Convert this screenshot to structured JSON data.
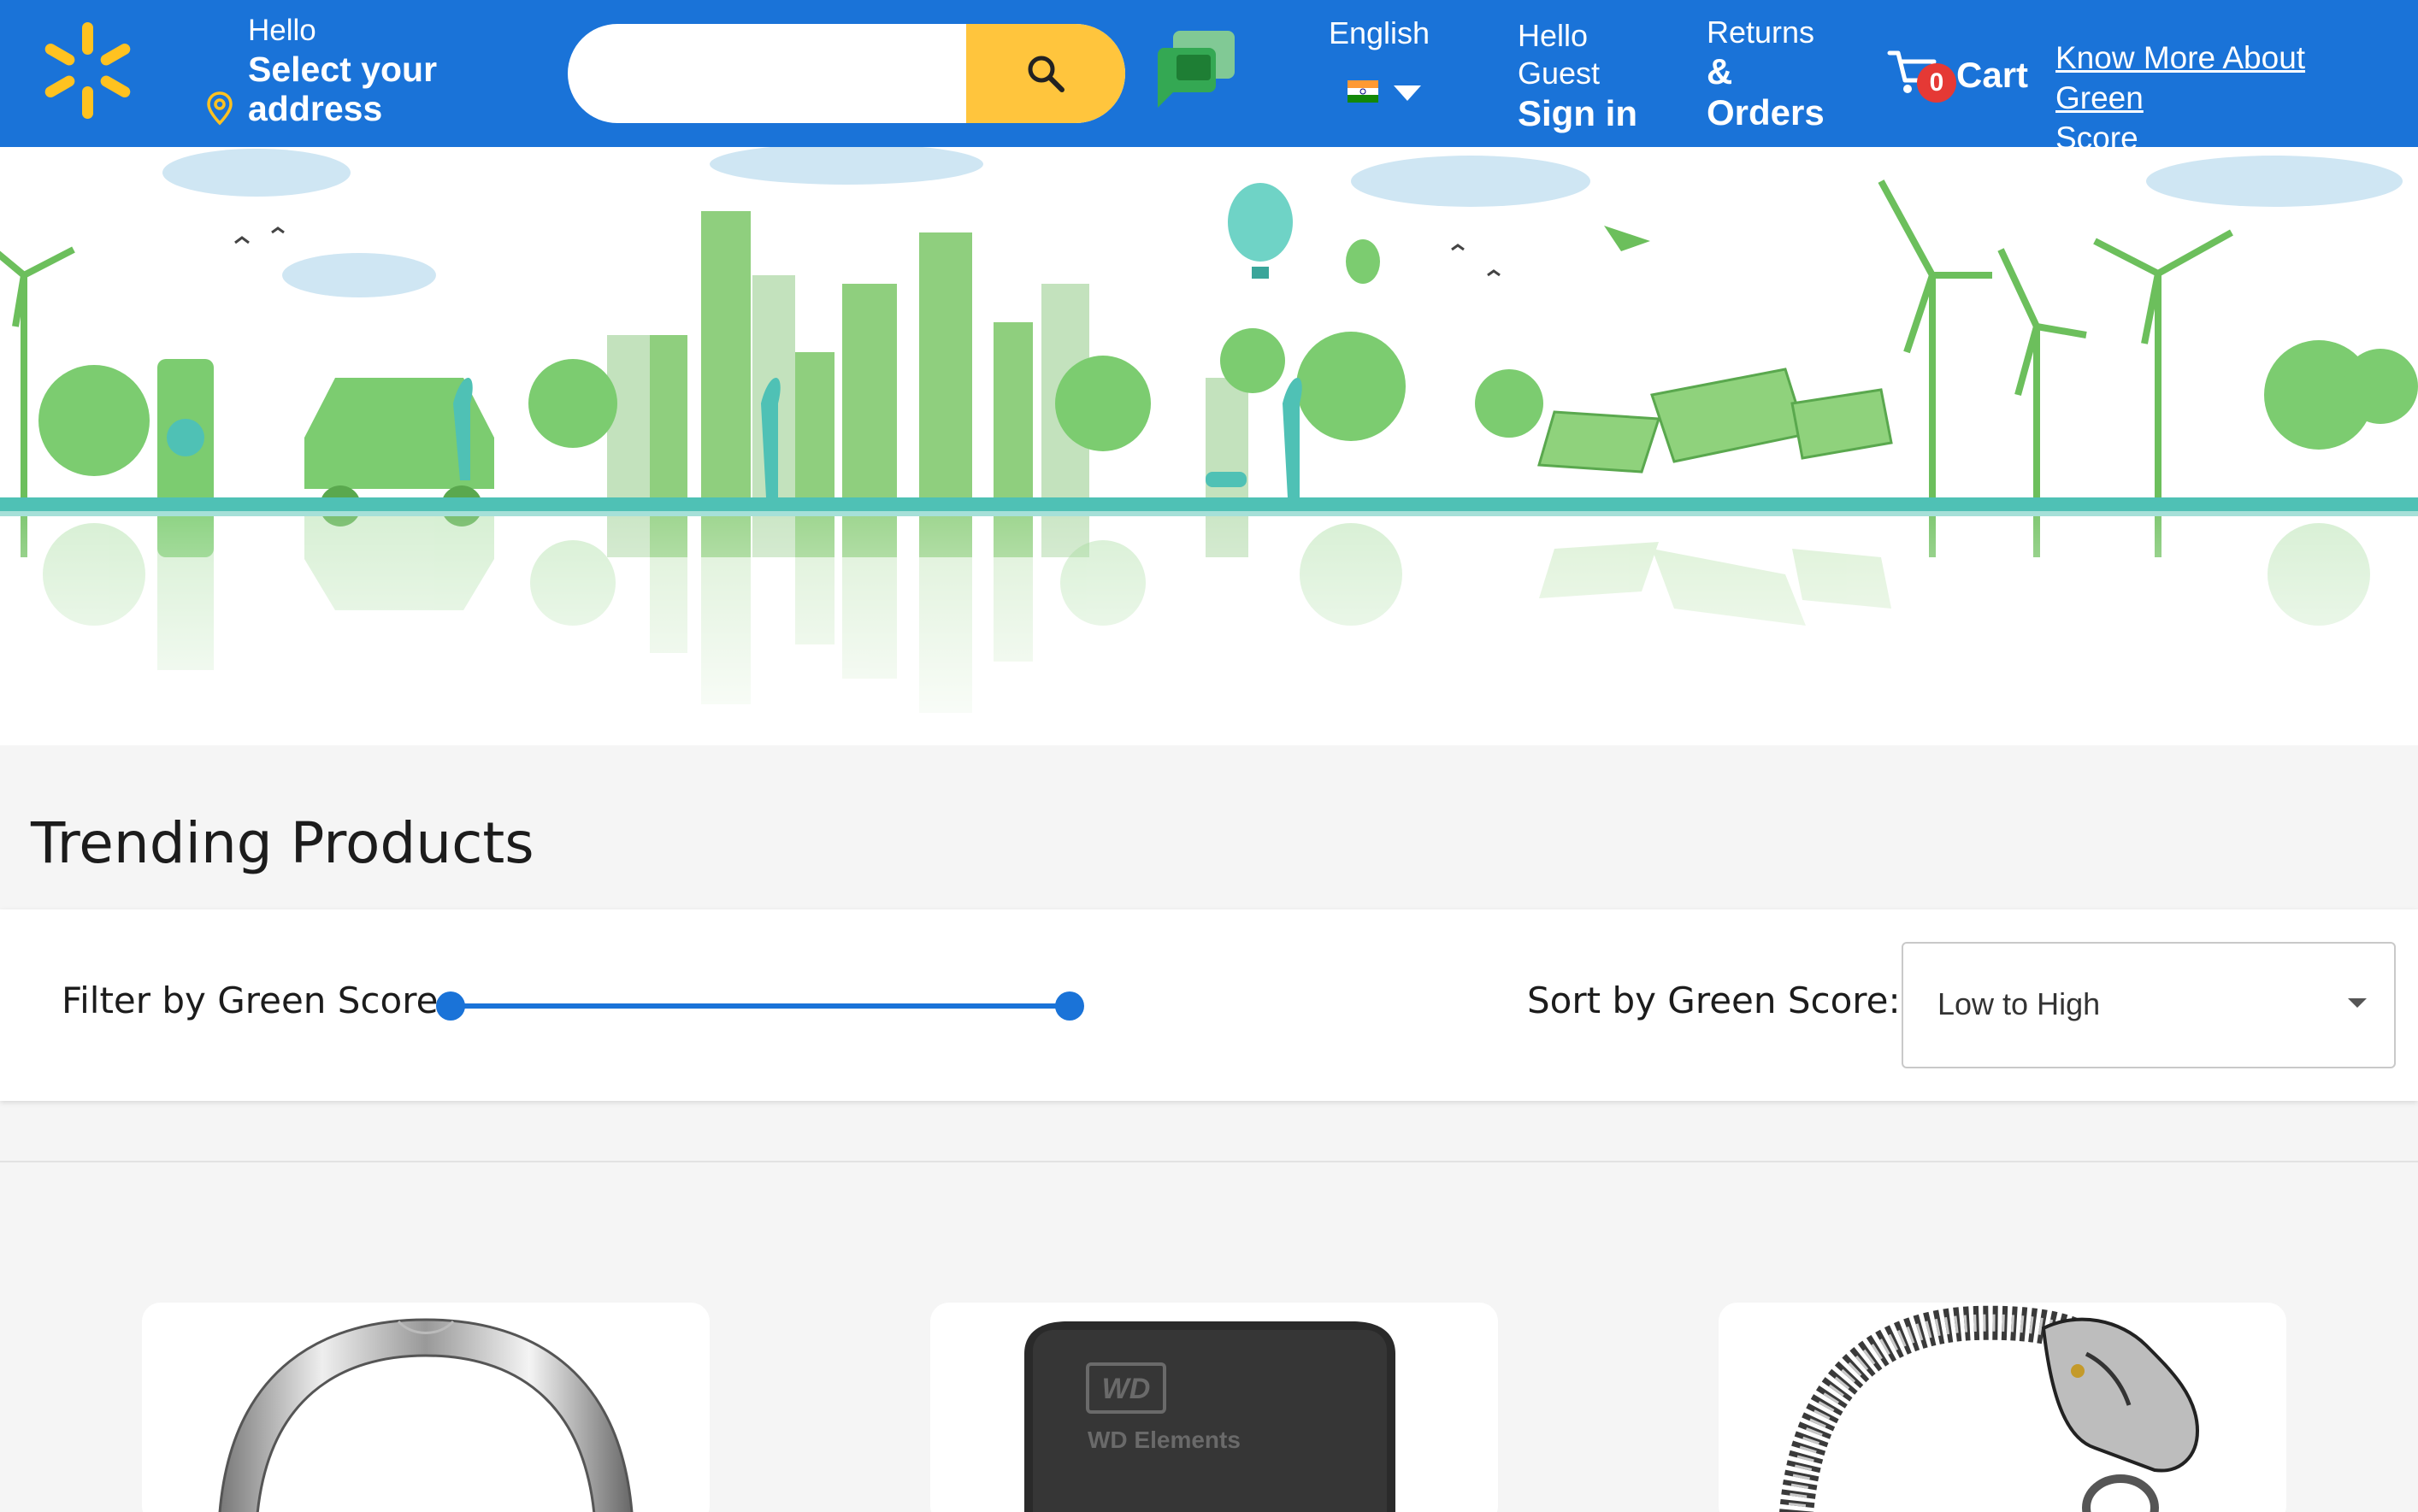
{
  "header": {
    "address": {
      "hello": "Hello",
      "line1": "Select your",
      "line2": "address"
    },
    "search": {
      "value": "",
      "placeholder": ""
    },
    "language": {
      "label": "English"
    },
    "account": {
      "line1": "Hello",
      "line2": "Guest",
      "line3": "Sign in"
    },
    "returns": {
      "line1": "Returns",
      "line2": "&",
      "line3": "Orders"
    },
    "cart": {
      "count": "0",
      "label": "Cart"
    },
    "know_more": {
      "line1": "Know More About Green",
      "line2": "Score"
    },
    "icons": [
      "walmart-spark-icon",
      "location-pin-icon",
      "search-icon",
      "chat-icon",
      "india-flag-icon",
      "chevron-down-icon",
      "cart-icon"
    ]
  },
  "banner": {
    "illustration": "green-city-skyline"
  },
  "trending": {
    "title": "Trending Products",
    "filter_label": "Filter by Green Score:",
    "filter_range": {
      "min_fraction": 0,
      "max_fraction": 1
    },
    "sort_label": "Sort by Green Score:",
    "sort_value": "Low to High"
  },
  "products": [
    {
      "image": "silver-ring"
    },
    {
      "image": "wd-elements-hard-drive",
      "brand_text": "WD Elements",
      "logo_text": "WD"
    },
    {
      "image": "dragon-chain-bracelet"
    }
  ],
  "colors": {
    "header_bg": "#1a73d8",
    "search_button": "#ffc53d",
    "spark": "#ffc220",
    "chat": "#34a853",
    "cart_badge": "#e53935",
    "green": "#6cbf5c",
    "teal": "#4fc1b5",
    "page_bg": "#f5f5f5"
  }
}
